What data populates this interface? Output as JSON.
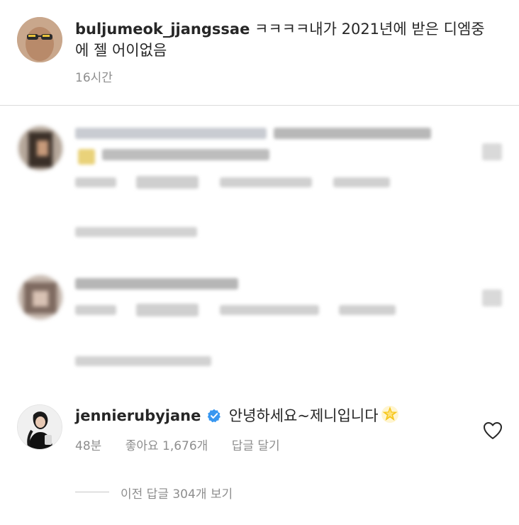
{
  "post": {
    "username": "buljumeok_jjangssae",
    "caption": "ㅋㅋㅋㅋ내가 2021년에 받은 디엠중에 젤 어이없음",
    "caption_line1": "ㅋㅋㅋㅋ내가 2021년에 받은 디엠중",
    "caption_line2": "에 젤 어이없음",
    "time": "16시간"
  },
  "comments": [
    {
      "blurred": true
    },
    {
      "blurred": true
    }
  ],
  "reply": {
    "username": "jennierubyjane",
    "verified": true,
    "text": "안녕하세요~제니입니다",
    "emoji": "🌟",
    "time": "48분",
    "likes": "좋아요 1,676개",
    "reply_label": "답글 달기",
    "view_replies": "이전 답글 304개 보기"
  },
  "icons": {
    "verified": "verified-badge-icon",
    "heart": "heart-outline-icon",
    "star": "glowing-star-icon"
  },
  "colors": {
    "verified_blue": "#3897f0",
    "meta_gray": "#8e8e8e",
    "text": "#262626"
  }
}
